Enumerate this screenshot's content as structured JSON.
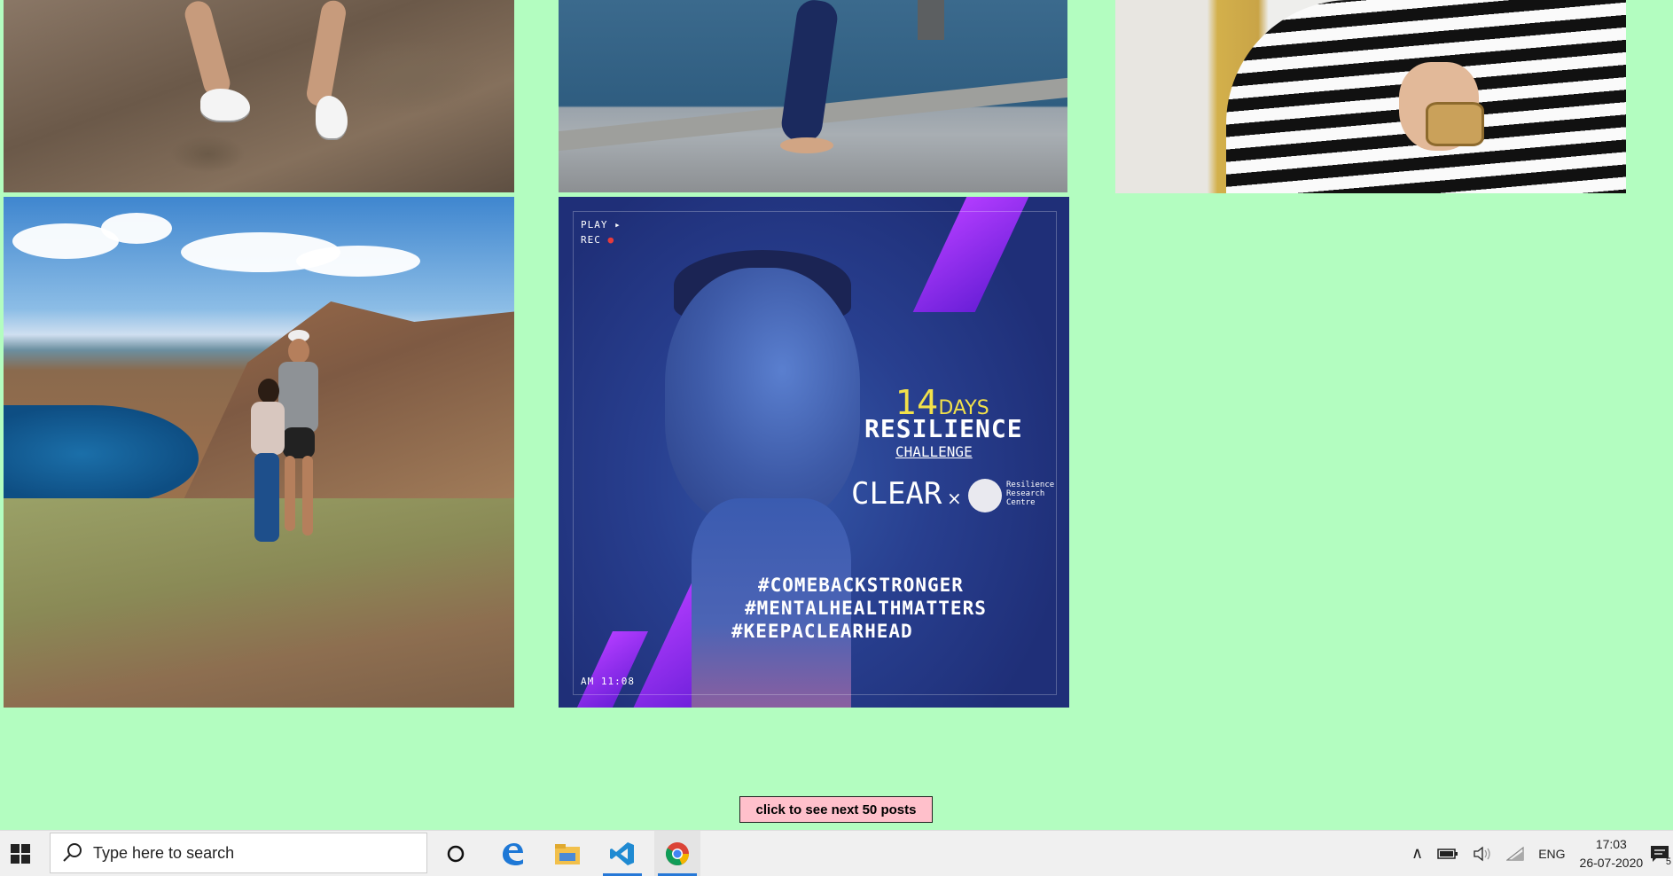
{
  "load_more_label": "click to see next 50 posts",
  "ad": {
    "play": "PLAY ▸",
    "rec": "REC",
    "days_num": "14",
    "days_word": "DAYS",
    "resilience": "RESILIENCE",
    "challenge": "CHALLENGE",
    "brand": "CLEAR",
    "times": "×",
    "partner": [
      "Resilience",
      "Research",
      "Centre"
    ],
    "hashtags": [
      "#COMEBACKSTRONGER",
      "#MENTALHEALTHMATTERS",
      "#KEEPACLEARHEAD"
    ],
    "time_stamp": "AM 11:08"
  },
  "taskbar": {
    "search_placeholder": "Type here to search",
    "language": "ENG",
    "time": "17:03",
    "date": "26-07-2020",
    "notification_count": "5"
  },
  "icons": [
    "windows-icon",
    "search-icon",
    "cortana-icon",
    "edge-icon",
    "file-explorer-icon",
    "vscode-icon",
    "chrome-icon",
    "chevron-up-icon",
    "battery-icon",
    "volume-icon",
    "wifi-icon",
    "notification-icon"
  ]
}
